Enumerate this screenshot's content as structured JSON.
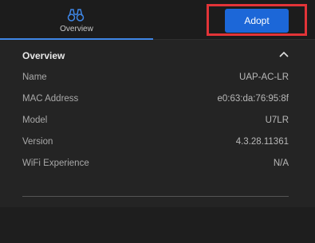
{
  "tabs": [
    {
      "label": "Overview",
      "icon": "binoculars-icon",
      "active": true
    }
  ],
  "actions": {
    "adopt_label": "Adopt"
  },
  "overview": {
    "title": "Overview",
    "rows": [
      {
        "label": "Name",
        "value": "UAP-AC-LR"
      },
      {
        "label": "MAC Address",
        "value": "e0:63:da:76:95:8f"
      },
      {
        "label": "Model",
        "value": "U7LR"
      },
      {
        "label": "Version",
        "value": "4.3.28.11361"
      },
      {
        "label": "WiFi Experience",
        "value": "N/A"
      }
    ]
  },
  "colors": {
    "accent": "#1c67d8",
    "tab_underline": "#3f86e6",
    "highlight": "#e23438",
    "background": "#242424"
  }
}
